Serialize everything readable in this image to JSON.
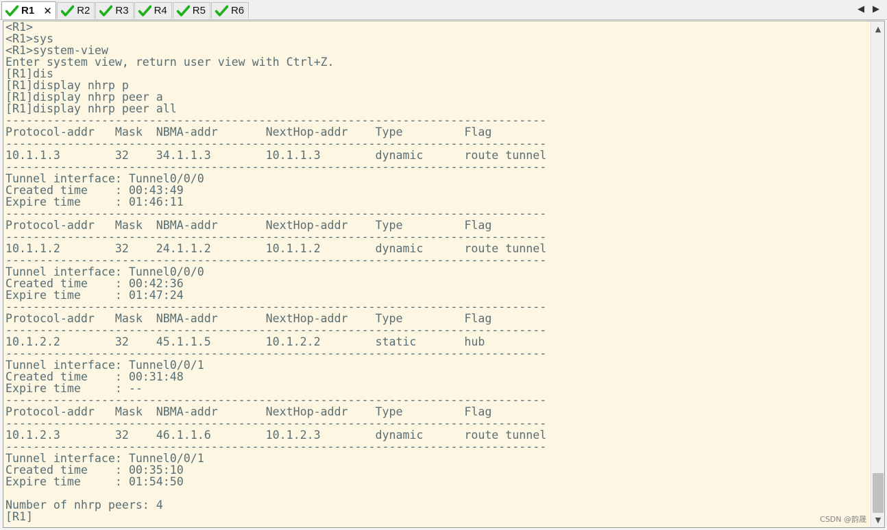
{
  "tabs": [
    {
      "label": "R1",
      "active": true,
      "status_icon": "check-icon",
      "closable": true
    },
    {
      "label": "R2",
      "active": false,
      "status_icon": "check-icon",
      "closable": false
    },
    {
      "label": "R3",
      "active": false,
      "status_icon": "check-icon",
      "closable": false
    },
    {
      "label": "R4",
      "active": false,
      "status_icon": "check-icon",
      "closable": false
    },
    {
      "label": "R5",
      "active": false,
      "status_icon": "check-icon",
      "closable": false
    },
    {
      "label": "R6",
      "active": false,
      "status_icon": "check-icon",
      "closable": false
    }
  ],
  "tab_close_glyph": "✕",
  "tab_nav": {
    "prev_glyph": "◀",
    "next_glyph": "▶"
  },
  "scrollbar": {
    "up_glyph": "▲",
    "down_glyph": "▼",
    "position_fraction": 1.0
  },
  "colors": {
    "terminal_bg": "#fdf6e3",
    "terminal_fg": "#586e75",
    "check_green": "#1db11d"
  },
  "terminal": {
    "lines": [
      "<R1>",
      "<R1>sys",
      "<R1>system-view",
      "Enter system view, return user view with Ctrl+Z.",
      "[R1]dis",
      "[R1]display nhrp p",
      "[R1]display nhrp peer a",
      "[R1]display nhrp peer all",
      "-------------------------------------------------------------------------------",
      "Protocol-addr   Mask  NBMA-addr       NextHop-addr    Type         Flag",
      "-------------------------------------------------------------------------------",
      "10.1.1.3        32    34.1.1.3        10.1.1.3        dynamic      route tunnel",
      "-------------------------------------------------------------------------------",
      "Tunnel interface: Tunnel0/0/0",
      "Created time    : 00:43:49",
      "Expire time     : 01:46:11",
      "-------------------------------------------------------------------------------",
      "Protocol-addr   Mask  NBMA-addr       NextHop-addr    Type         Flag",
      "-------------------------------------------------------------------------------",
      "10.1.1.2        32    24.1.1.2        10.1.1.2        dynamic      route tunnel",
      "-------------------------------------------------------------------------------",
      "Tunnel interface: Tunnel0/0/0",
      "Created time    : 00:42:36",
      "Expire time     : 01:47:24",
      "-------------------------------------------------------------------------------",
      "Protocol-addr   Mask  NBMA-addr       NextHop-addr    Type         Flag",
      "-------------------------------------------------------------------------------",
      "10.1.2.2        32    45.1.1.5        10.1.2.2        static       hub",
      "-------------------------------------------------------------------------------",
      "Tunnel interface: Tunnel0/0/1",
      "Created time    : 00:31:48",
      "Expire time     : --",
      "-------------------------------------------------------------------------------",
      "Protocol-addr   Mask  NBMA-addr       NextHop-addr    Type         Flag",
      "-------------------------------------------------------------------------------",
      "10.1.2.3        32    46.1.1.6        10.1.2.3        dynamic      route tunnel",
      "-------------------------------------------------------------------------------",
      "Tunnel interface: Tunnel0/0/1",
      "Created time    : 00:35:10",
      "Expire time     : 01:54:50",
      "",
      "Number of nhrp peers: 4",
      "[R1]"
    ]
  },
  "watermark": "CSDN @韵晟"
}
